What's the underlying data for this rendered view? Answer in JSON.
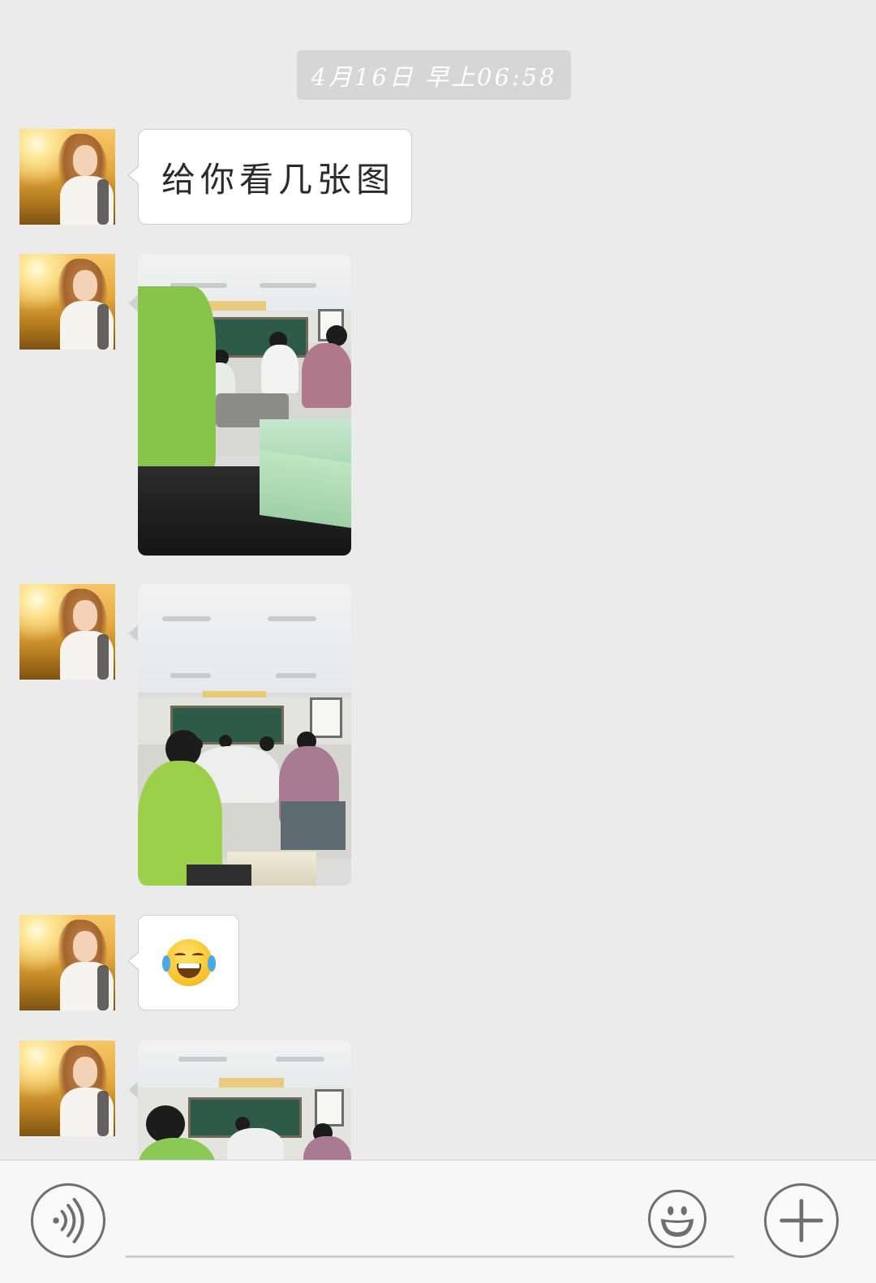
{
  "chat": {
    "timestamp": "4月16日 早上06:58",
    "messages": [
      {
        "type": "text",
        "text": "给你看几张图"
      },
      {
        "type": "image",
        "description": "classroom photo 1"
      },
      {
        "type": "image",
        "description": "classroom photo 2"
      },
      {
        "type": "emoji",
        "emoji": "😂",
        "icon": "tears-of-joy-emoji"
      },
      {
        "type": "image",
        "description": "classroom photo 3 (partially visible)"
      }
    ]
  },
  "input_bar": {
    "voice_icon": "voice-input-icon",
    "text_value": "",
    "emoji_icon": "emoji-panel-icon",
    "plus_icon": "more-actions-plus-icon"
  },
  "colors": {
    "chat_background": "#ebebeb",
    "bubble": "#ffffff",
    "timestamp_pill": "#d6d6d6",
    "input_bar": "#f7f7f7",
    "icon_stroke": "#6f6f6f"
  }
}
